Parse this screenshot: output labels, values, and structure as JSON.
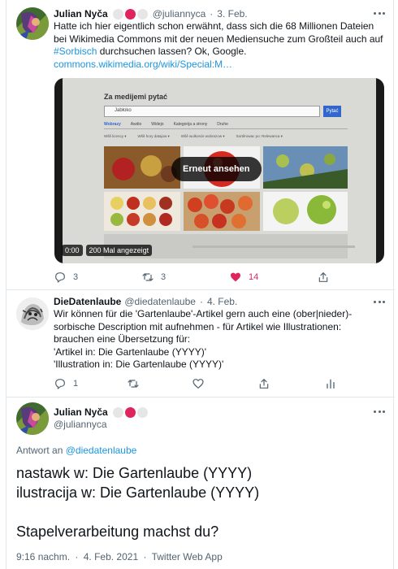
{
  "tweet1": {
    "name": "Julian Nyča",
    "handle": "@juliannyca",
    "date": "3. Feb.",
    "text_line1": "Hatte ich hier eigentlich schon erwähnt, dass sich die 68 Millionen Dateien",
    "text_line2": "bei Wikimedia Commons mit der neuen Mediensuche zum Großteil auch auf",
    "hashtag": "#Sorbisch",
    "text_line3_rest": " durchsuchen lassen? Ok, Google.",
    "link": "commons.wikimedia.org/wiki/Special:M…",
    "video": {
      "page_title": "Za medijemi pytać",
      "search_value": "Jabłoko",
      "search_button": "Pytać",
      "tabs": [
        "Wobrazy",
        "Awdio",
        "Widejo",
        "Kategorija a strony",
        "Druhe"
      ],
      "filters": [
        "Wšě licency",
        "Wšě hory datajow",
        "Wšě wulkosće wobrazow",
        "Sortěrowac po: Relewanca"
      ],
      "replay_label": "Erneut ansehen",
      "time": "0:00",
      "views": "200 Mal angezeigt"
    },
    "reply_count": "3",
    "retweet_count": "3",
    "like_count": "14"
  },
  "tweet2": {
    "name": "DieDatenlaube",
    "handle": "@diedatenlaube",
    "date": "4. Feb.",
    "lines": [
      "Wir können für die 'Gartenlaube'-Artikel gern auch eine (ober|nieder)-",
      "sorbische Description mit aufnehmen - für Artikel wie Illustrationen:",
      "brauchen eine Übersetzung für:",
      "'Artikel in: Die Gartenlaube (YYYY)'",
      "'Illustration in: Die Gartenlaube (YYYY)'"
    ],
    "reply_count": "1"
  },
  "main": {
    "name": "Julian Nyča",
    "handle": "@juliannyca",
    "reply_prefix": "Antwort an",
    "reply_to": "@diedatenlaube",
    "line1": "nastawk w: Die Gartenlaube (YYYY)",
    "line2": "ilustracija w: Die Gartenlaube (YYYY)",
    "line3": "Stapelverarbeitung machst du?",
    "time": "9:16 nachm.",
    "date": "4. Feb. 2021",
    "source": "Twitter Web App"
  },
  "colors": {
    "accent": "#1b95e0",
    "like": "#e0245e",
    "muted": "#536471",
    "flag_red": "#e0245e",
    "flag_grey": "#e6e6e6"
  }
}
